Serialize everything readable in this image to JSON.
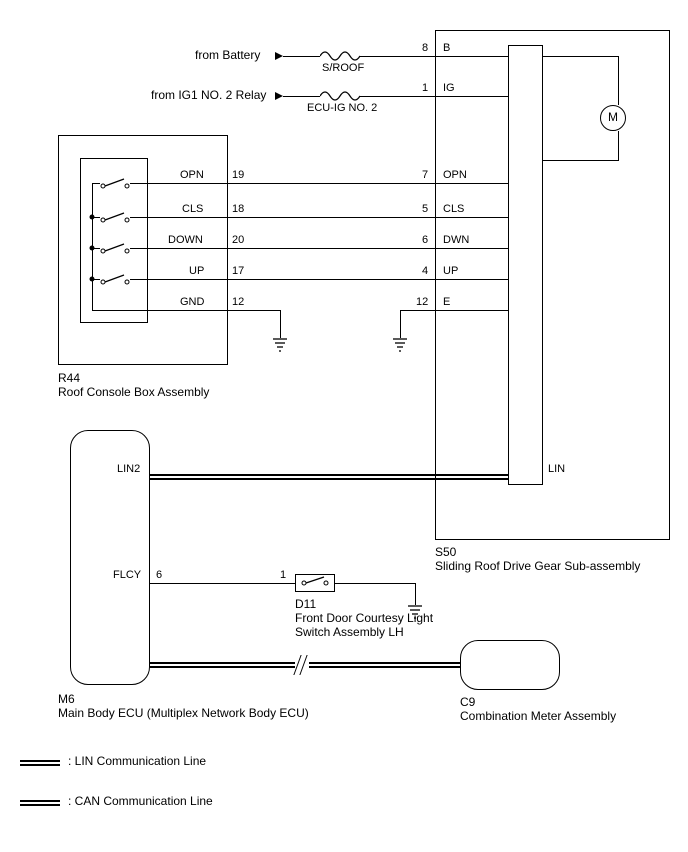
{
  "sources": {
    "battery": "from Battery",
    "ig1relay": "from IG1 NO. 2 Relay"
  },
  "fuses": {
    "sroof": "S/ROOF",
    "ecuig": "ECU-IG NO. 2"
  },
  "s50": {
    "id": "S50",
    "name": "Sliding Roof Drive Gear Sub-assembly",
    "pins": {
      "b": {
        "num": "8",
        "name": "B"
      },
      "ig": {
        "num": "1",
        "name": "IG"
      },
      "opn": {
        "num": "7",
        "name": "OPN"
      },
      "cls": {
        "num": "5",
        "name": "CLS"
      },
      "dwn": {
        "num": "6",
        "name": "DWN"
      },
      "up": {
        "num": "4",
        "name": "UP"
      },
      "e": {
        "num": "12",
        "name": "E"
      },
      "lin": {
        "name": "LIN"
      }
    },
    "motor": "M"
  },
  "r44": {
    "id": "R44",
    "name": "Roof Console Box Assembly",
    "pins": {
      "opn": {
        "num": "19",
        "name": "OPN"
      },
      "cls": {
        "num": "18",
        "name": "CLS"
      },
      "down": {
        "num": "20",
        "name": "DOWN"
      },
      "up": {
        "num": "17",
        "name": "UP"
      },
      "gnd": {
        "num": "12",
        "name": "GND"
      }
    }
  },
  "m6": {
    "id": "M6",
    "name": "Main Body ECU (Multiplex Network Body ECU)",
    "pins": {
      "lin2": {
        "name": "LIN2"
      },
      "flcy": {
        "num": "6",
        "name": "FLCY"
      }
    }
  },
  "d11": {
    "id": "D11",
    "name_l1": "Front Door Courtesy Light",
    "name_l2": "Switch Assembly LH",
    "pin1": "1"
  },
  "c9": {
    "id": "C9",
    "name": "Combination Meter Assembly"
  },
  "legend": {
    "lin": ": LIN Communication Line",
    "can": ": CAN Communication Line"
  }
}
